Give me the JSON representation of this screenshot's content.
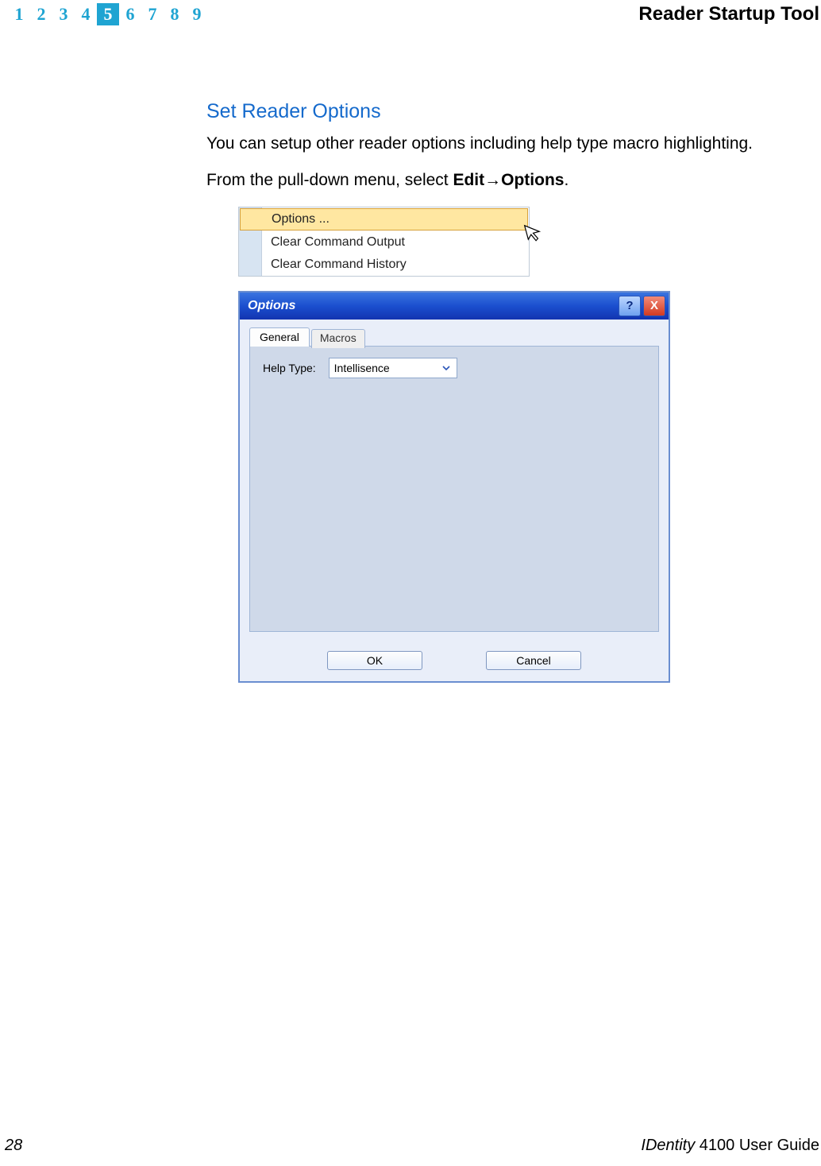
{
  "header": {
    "chapters": [
      "1",
      "2",
      "3",
      "4",
      "5",
      "6",
      "7",
      "8",
      "9"
    ],
    "active": "5",
    "title": "Reader Startup Tool"
  },
  "section": {
    "heading": "Set Reader Options",
    "p1": "You can setup other reader options including help type macro highlighting.",
    "p2_pre": "From the pull-down menu, select ",
    "p2_b1": "Edit",
    "p2_arrow": "→",
    "p2_b2": "Options",
    "p2_post": "."
  },
  "menu": {
    "items": [
      "Options ...",
      "Clear Command Output",
      "Clear Command History"
    ]
  },
  "dialog": {
    "title": "Options",
    "help": "?",
    "close": "X",
    "tabs": {
      "general": "General",
      "macros": "Macros"
    },
    "label": "Help Type:",
    "select_value": "Intellisence",
    "ok": "OK",
    "cancel": "Cancel"
  },
  "footer": {
    "page": "28",
    "brand": "IDentity",
    "rest": " 4100 User Guide"
  }
}
